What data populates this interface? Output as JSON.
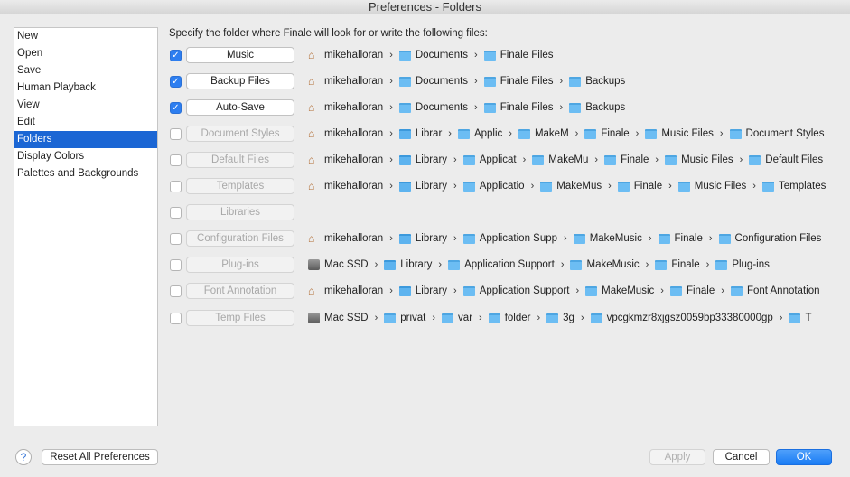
{
  "window": {
    "title": "Preferences - Folders"
  },
  "sidebar": {
    "items": [
      {
        "label": "New"
      },
      {
        "label": "Open"
      },
      {
        "label": "Save"
      },
      {
        "label": "Human Playback"
      },
      {
        "label": "View"
      },
      {
        "label": "Edit"
      },
      {
        "label": "Folders",
        "selected": true
      },
      {
        "label": "Display Colors"
      },
      {
        "label": "Palettes and Backgrounds"
      }
    ]
  },
  "main": {
    "instruction": "Specify the folder where Finale will look for or write the following files:",
    "rows": [
      {
        "label": "Music",
        "checked": true,
        "path": [
          {
            "icon": "home",
            "name": "mikehalloran"
          },
          {
            "icon": "folder",
            "name": "Documents"
          },
          {
            "icon": "folder",
            "name": "Finale Files"
          }
        ]
      },
      {
        "label": "Backup Files",
        "checked": true,
        "path": [
          {
            "icon": "home",
            "name": "mikehalloran"
          },
          {
            "icon": "folder",
            "name": "Documents"
          },
          {
            "icon": "folder",
            "name": "Finale Files"
          },
          {
            "icon": "folder",
            "name": "Backups"
          }
        ]
      },
      {
        "label": "Auto-Save",
        "checked": true,
        "path": [
          {
            "icon": "home",
            "name": "mikehalloran"
          },
          {
            "icon": "folder",
            "name": "Documents"
          },
          {
            "icon": "folder",
            "name": "Finale Files"
          },
          {
            "icon": "folder",
            "name": "Backups"
          }
        ]
      },
      {
        "label": "Document Styles",
        "checked": false,
        "path": [
          {
            "icon": "home",
            "name": "mikehalloran"
          },
          {
            "icon": "library",
            "name": "Librar"
          },
          {
            "icon": "folder",
            "name": "Applic"
          },
          {
            "icon": "folder",
            "name": "MakeM"
          },
          {
            "icon": "folder",
            "name": "Finale"
          },
          {
            "icon": "folder",
            "name": "Music Files"
          },
          {
            "icon": "folder",
            "name": "Document Styles"
          }
        ]
      },
      {
        "label": "Default Files",
        "checked": false,
        "path": [
          {
            "icon": "home",
            "name": "mikehalloran"
          },
          {
            "icon": "library",
            "name": "Library"
          },
          {
            "icon": "folder",
            "name": "Applicat"
          },
          {
            "icon": "folder",
            "name": "MakeMu"
          },
          {
            "icon": "folder",
            "name": "Finale"
          },
          {
            "icon": "folder",
            "name": "Music Files"
          },
          {
            "icon": "folder",
            "name": "Default Files"
          }
        ]
      },
      {
        "label": "Templates",
        "checked": false,
        "path": [
          {
            "icon": "home",
            "name": "mikehalloran"
          },
          {
            "icon": "library",
            "name": "Library"
          },
          {
            "icon": "folder",
            "name": "Applicatio"
          },
          {
            "icon": "folder",
            "name": "MakeMus"
          },
          {
            "icon": "folder",
            "name": "Finale"
          },
          {
            "icon": "folder",
            "name": "Music Files"
          },
          {
            "icon": "folder",
            "name": "Templates"
          }
        ]
      },
      {
        "label": "Libraries",
        "checked": false,
        "path": []
      },
      {
        "label": "Configuration Files",
        "checked": false,
        "path": [
          {
            "icon": "home",
            "name": "mikehalloran"
          },
          {
            "icon": "library",
            "name": "Library"
          },
          {
            "icon": "folder",
            "name": "Application Supp"
          },
          {
            "icon": "folder",
            "name": "MakeMusic"
          },
          {
            "icon": "folder",
            "name": "Finale"
          },
          {
            "icon": "folder",
            "name": "Configuration Files"
          }
        ]
      },
      {
        "label": "Plug-ins",
        "checked": false,
        "path": [
          {
            "icon": "disk",
            "name": "Mac SSD"
          },
          {
            "icon": "library",
            "name": "Library"
          },
          {
            "icon": "folder",
            "name": "Application Support"
          },
          {
            "icon": "folder",
            "name": "MakeMusic"
          },
          {
            "icon": "folder",
            "name": "Finale"
          },
          {
            "icon": "folder",
            "name": "Plug-ins"
          }
        ]
      },
      {
        "label": "Font Annotation",
        "checked": false,
        "path": [
          {
            "icon": "home",
            "name": "mikehalloran"
          },
          {
            "icon": "library",
            "name": "Library"
          },
          {
            "icon": "folder",
            "name": "Application Support"
          },
          {
            "icon": "folder",
            "name": "MakeMusic"
          },
          {
            "icon": "folder",
            "name": "Finale"
          },
          {
            "icon": "folder",
            "name": "Font Annotation"
          }
        ]
      },
      {
        "label": "Temp Files",
        "checked": false,
        "path": [
          {
            "icon": "disk",
            "name": "Mac SSD"
          },
          {
            "icon": "folder",
            "name": "privat"
          },
          {
            "icon": "folder",
            "name": "var"
          },
          {
            "icon": "folder",
            "name": "folder"
          },
          {
            "icon": "folder",
            "name": "3g"
          },
          {
            "icon": "folder",
            "name": "vpcgkmzr8xjgsz0059bp33380000gp"
          },
          {
            "icon": "folder",
            "name": "T"
          }
        ]
      }
    ]
  },
  "footer": {
    "help": "?",
    "reset": "Reset All Preferences",
    "apply": "Apply",
    "cancel": "Cancel",
    "ok": "OK"
  },
  "colors": {
    "accent": "#1b66d4",
    "ok_button": "#1f83f5"
  }
}
